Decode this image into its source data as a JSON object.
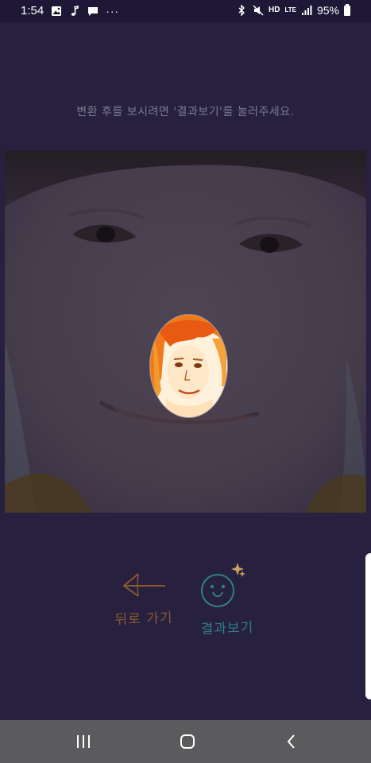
{
  "status_bar": {
    "time": "1:54",
    "more": "···",
    "hd": "HD",
    "lte": "LTE",
    "battery_percent": "95%",
    "icons": [
      "gallery-icon",
      "music-note-icon",
      "message-icon",
      "bluetooth-icon",
      "mute-icon",
      "signal-icon",
      "battery-icon"
    ]
  },
  "instruction": "변환 후를 보시려면 '결과보기'를 눌러주세요.",
  "buttons": {
    "back_label": "뒤로 가기",
    "result_label": "결과보기"
  },
  "colors": {
    "background": "#27203f",
    "instruction_text": "#7d7a90",
    "back_accent": "#8a5a2e",
    "result_accent": "#2f7f86",
    "nav_bar": "#5b5b5d"
  },
  "nav": {
    "icons": [
      "recent-apps-icon",
      "home-icon",
      "back-icon"
    ]
  }
}
